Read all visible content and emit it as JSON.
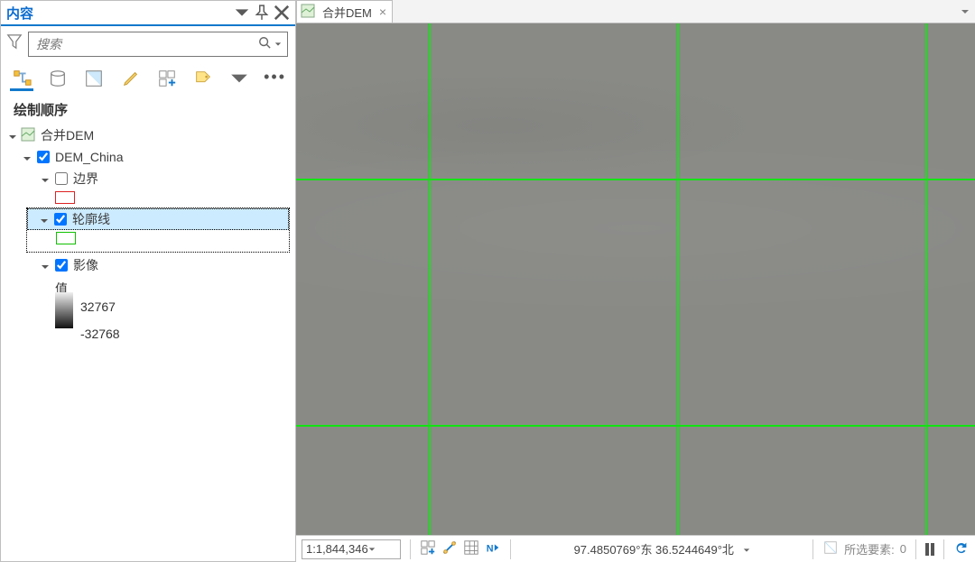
{
  "panel": {
    "title": "内容",
    "search_placeholder": "搜索",
    "section_title": "绘制顺序"
  },
  "tree": {
    "map_name": "合并DEM",
    "group_layer": "DEM_China",
    "sublayers": {
      "boundary": "边界",
      "outline": "轮廓线",
      "image": "影像"
    },
    "value_label": "值",
    "value_max": "32767",
    "value_min": "-32768"
  },
  "map_tab": {
    "label": "合并DEM"
  },
  "status": {
    "scale": "1:1,844,346",
    "coords": "97.4850769°东 36.5244649°北",
    "selection_label": "所选要素:",
    "selection_count": "0"
  },
  "colors": {
    "accent": "#1279cc",
    "grid": "#12e412"
  }
}
